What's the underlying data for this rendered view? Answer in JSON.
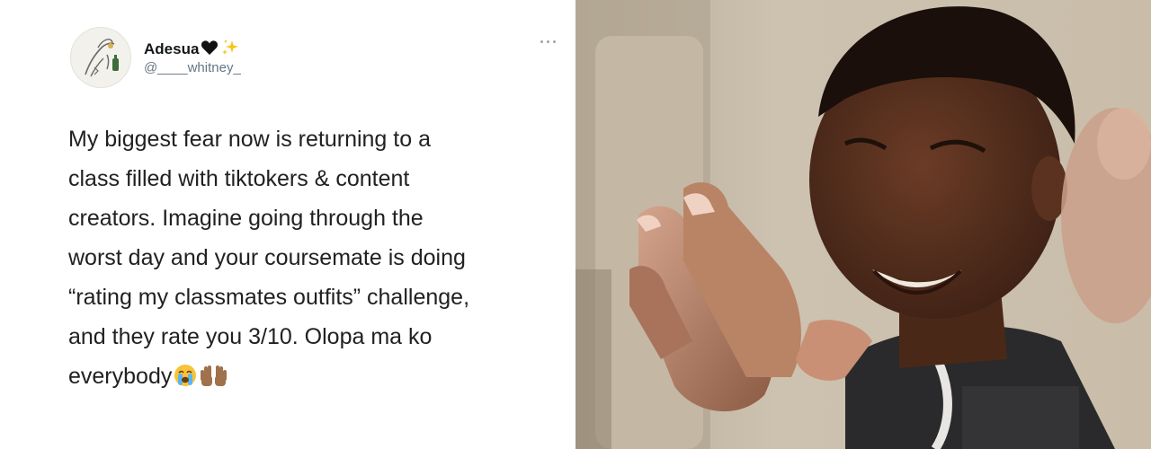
{
  "tweet": {
    "display_name": "Adesua",
    "name_emojis": [
      "black-heart-icon",
      "sparkles-icon"
    ],
    "handle": "@____whitney_",
    "text_lines": [
      "My biggest fear now is returning to a",
      "class filled with tiktokers & content",
      "creators. Imagine going through the",
      "worst day and your coursemate is doing",
      "“rating my classmates outfits” challenge,",
      "and they rate you 3/10. Olopa ma ko",
      "everybody"
    ],
    "trailing_emojis": [
      "loudly-crying-face-icon",
      "raised-hands-icon"
    ]
  },
  "colors": {
    "name": "#14171a",
    "handle": "#657786",
    "body_text": "#212121",
    "more_dots": "#9aa6b2"
  },
  "reaction_photo": {
    "description_icon": "laughing-man-photo"
  }
}
